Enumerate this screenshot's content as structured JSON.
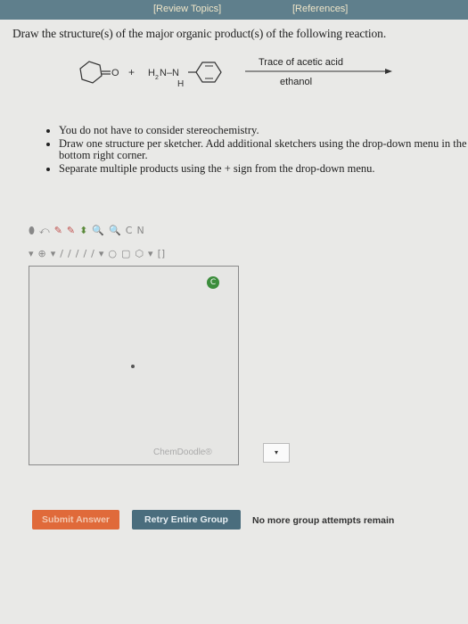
{
  "top_nav": {
    "review_topics": "[Review Topics]",
    "references": "[References]"
  },
  "question": {
    "prompt": "Draw the structure(s) of the major organic product(s) of the following reaction."
  },
  "reaction": {
    "plus": "+",
    "reagent_amine_prefix": "H",
    "reagent_amine_sub": "2",
    "reagent_amine_rest": "N–N",
    "reagent_nh_h": "H",
    "carbonyl_o": "O",
    "condition_top": "Trace of acetic acid",
    "condition_bottom": "ethanol"
  },
  "instructions": [
    "You do not have to consider stereochemistry.",
    "Draw one structure per sketcher. Add additional sketchers using the drop-down menu in the bottom right corner.",
    "Separate multiple products using the + sign from the drop-down menu."
  ],
  "sketcher": {
    "brand": "ChemDoodle®",
    "toolbar_row1": [
      "⬮",
      "⤺",
      "✎",
      "✎",
      "⬍",
      "🔍",
      "🔍",
      "C",
      "N"
    ],
    "toolbar_row2": [
      "▾",
      "⊕",
      "▾",
      "/",
      "/",
      "/",
      "/",
      "/",
      "▾",
      "○",
      "▢",
      "⬡",
      "▾",
      "[]"
    ]
  },
  "sketcher_menu": {
    "dropdown_glyph": "▾"
  },
  "buttons": {
    "submit": "Submit Answer",
    "retry": "Retry Entire Group"
  },
  "status": {
    "attempts": "No more group attempts remain"
  }
}
